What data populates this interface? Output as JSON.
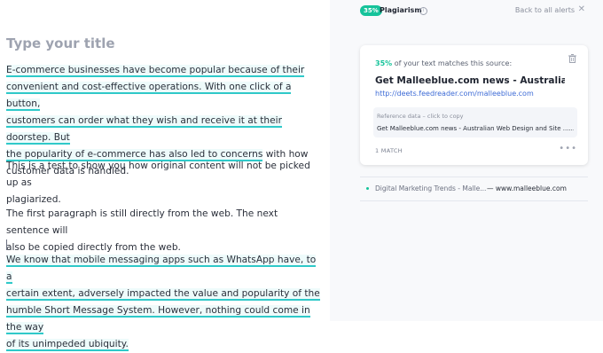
{
  "editor": {
    "title_placeholder": "Type your title",
    "paragraphs": [
      {
        "highlighted": [
          "E-commerce businesses have become popular because of their",
          "convenient and cost-effective operations. With one click of a button,",
          "customers can order what they wish and receive it at their doorstep. But",
          "the popularity of e-commerce has also led to concerns"
        ],
        "tail": [
          " with how",
          "customer data is handled."
        ]
      },
      {
        "lines": [
          "This is a test to show you how original content will not be picked up as",
          "plagiarized."
        ]
      },
      {
        "lines": [
          "The first paragraph is still directly from the web. The next sentence will",
          "also be copied directly from the web."
        ]
      },
      {
        "highlighted": [
          "We know that mobile messaging apps such as WhatsApp have, to a",
          "certain extent, adversely impacted the value and popularity of the",
          "humble Short Message System. However, nothing could come in the way",
          "of its unimpeded ubiquity."
        ]
      }
    ]
  },
  "panel": {
    "badge": "35%",
    "title": "Plagiarism",
    "info_icon": "info-icon",
    "back_label": "Back to all alerts",
    "close_icon": "close-icon",
    "card": {
      "match_pct": "35%",
      "match_text": " of your text matches this source:",
      "source_title": "Get Malleeblue.com news - Australian Web Design",
      "source_url": "http://deets.feedreader.com/malleeblue.com",
      "ref_label": "Reference data – click to copy",
      "ref_text": "Get Malleeblue.com news - Australian Web Design and Site ......",
      "match_count": "1 MATCH"
    },
    "alt_source": {
      "title": "Digital Marketing Trends - Malle...",
      "domain": "— www.malleeblue.com"
    }
  },
  "colors": {
    "accent": "#15c39a",
    "highlight": "#2fc9c9",
    "link": "#3d6bd6"
  }
}
